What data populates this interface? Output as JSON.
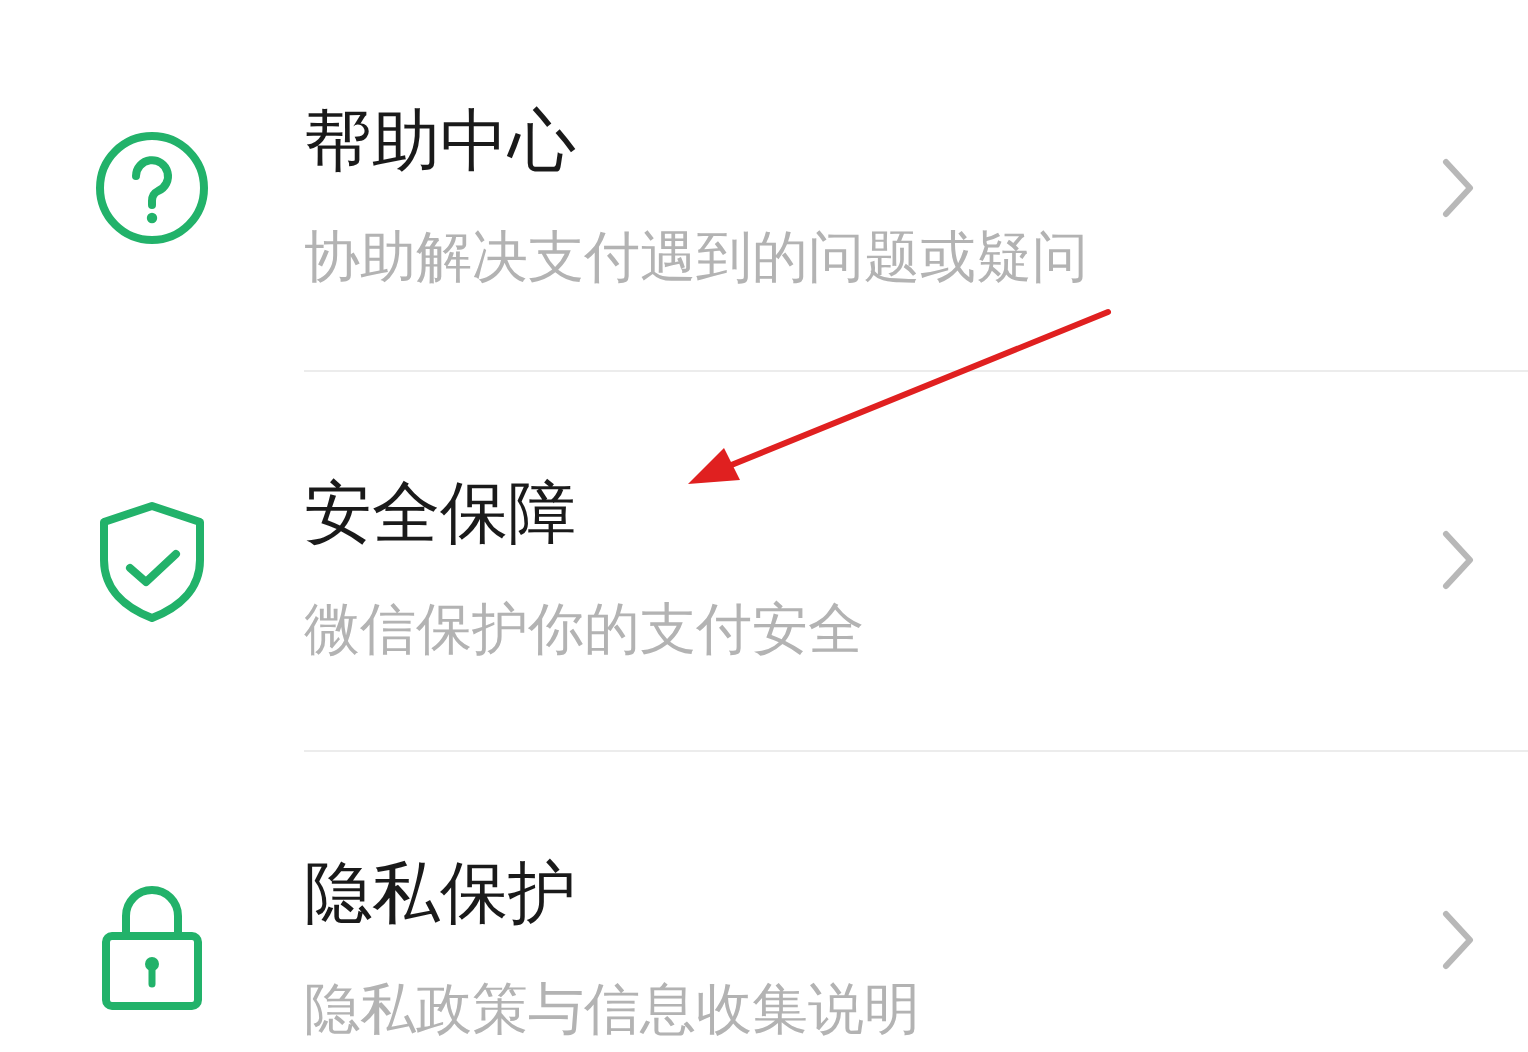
{
  "menu_items": [
    {
      "kind": "help",
      "title": "帮助中心",
      "subtitle": "协助解决支付遇到的问题或疑问"
    },
    {
      "kind": "shield",
      "title": "安全保障",
      "subtitle": "微信保护你的支付安全"
    },
    {
      "kind": "lock",
      "title": "隐私保护",
      "subtitle": "隐私政策与信息收集说明"
    }
  ]
}
